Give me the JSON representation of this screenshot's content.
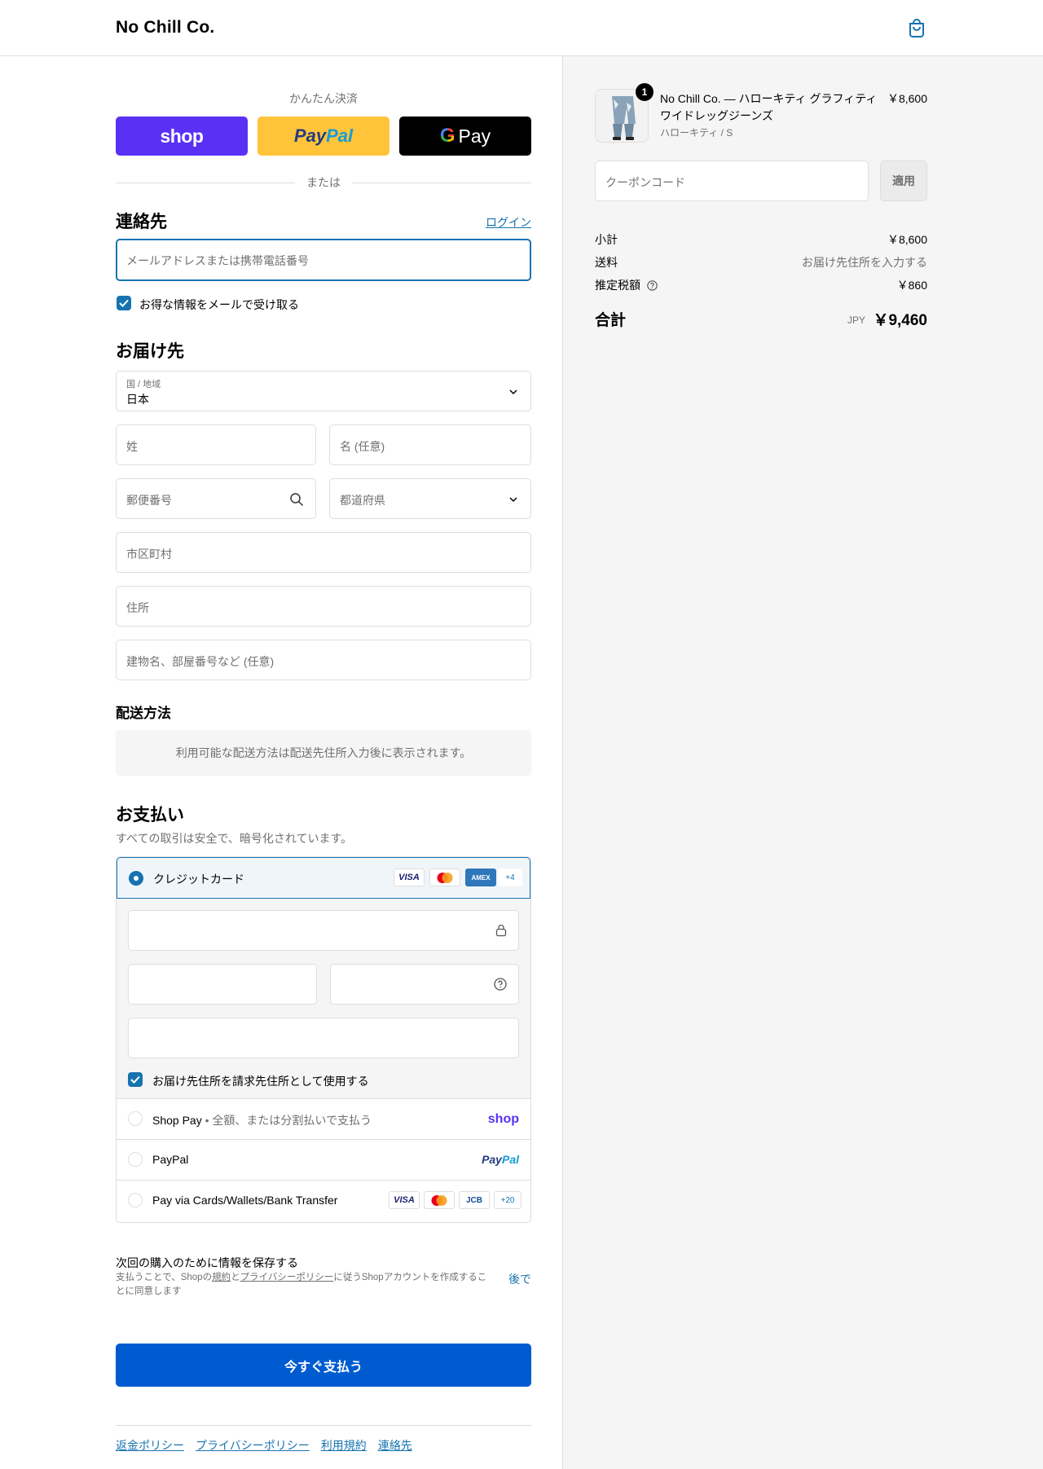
{
  "header": {
    "brand": "No Chill Co."
  },
  "express": {
    "title": "かんたん決済",
    "shop_label": "shop",
    "paypal_pay": "Pay",
    "paypal_pal": "Pal",
    "gpay_g": "G",
    "gpay_label": "Pay",
    "or_label": "または"
  },
  "contact": {
    "title": "連絡先",
    "login_link": "ログイン",
    "email_placeholder": "メールアドレスまたは携帯電話番号",
    "newsletter_label": "お得な情報をメールで受け取る",
    "newsletter_checked": true
  },
  "delivery": {
    "title": "お届け先",
    "country_label": "国 / 地域",
    "country_value": "日本",
    "last_name_placeholder": "姓",
    "first_name_placeholder": "名 (任意)",
    "postal_placeholder": "郵便番号",
    "prefecture_placeholder": "都道府県",
    "city_placeholder": "市区町村",
    "address_placeholder": "住所",
    "building_placeholder": "建物名、部屋番号など (任意)"
  },
  "shipping": {
    "title": "配送方法",
    "notice": "利用可能な配送方法は配送先住所入力後に表示されます。"
  },
  "payment": {
    "title": "お支払い",
    "subtitle": "すべての取引は安全で、暗号化されています。",
    "credit_card_label": "クレジットカード",
    "cc_badges": [
      "VISA",
      "MC",
      "AMEX",
      "+4"
    ],
    "billing_same_label": "お届け先住所を請求先住所として使用する",
    "billing_same_checked": true,
    "shop_pay_label": "Shop Pay",
    "shop_pay_desc": "• 全額、または分割払いで支払う",
    "shop_pay_logo": "shop",
    "paypal_label": "PayPal",
    "paypal_logo_pay": "Pay",
    "paypal_logo_pal": "Pal",
    "other_label": "Pay via Cards/Wallets/Bank Transfer",
    "other_badges": [
      "VISA",
      "MC",
      "JCB",
      "+20"
    ],
    "selected": "credit_card"
  },
  "save_info": {
    "title": "次回の購入のために情報を保存する",
    "desc_1": "支払うことで、Shopの",
    "terms_link": "規約",
    "desc_2": "と",
    "privacy_link": "プライバシーポリシー",
    "desc_3": "に従うShopアカウントを作成することに同意します",
    "later_label": "後で"
  },
  "pay_now_label": "今すぐ支払う",
  "footer": {
    "links": [
      "返金ポリシー",
      "プライバシーポリシー",
      "利用規約",
      "連絡先"
    ]
  },
  "summary": {
    "product": {
      "name": "No Chill Co. — ハローキティ グラフィティ ワイドレッグジーンズ",
      "variant": "ハローキティ / S",
      "price": "￥8,600",
      "quantity": "1"
    },
    "coupon_placeholder": "クーポンコード",
    "apply_label": "適用",
    "subtotal_label": "小計",
    "subtotal_value": "￥8,600",
    "shipping_label": "送料",
    "shipping_value": "お届け先住所を入力する",
    "tax_label": "推定税額",
    "tax_value": "￥860",
    "total_label": "合計",
    "currency": "JPY",
    "total_value": "￥9,460"
  },
  "colors": {
    "accent": "#1773b0",
    "pay_button": "#005bd1",
    "shop_purple": "#5a31f4",
    "paypal_yellow": "#ffc439"
  }
}
